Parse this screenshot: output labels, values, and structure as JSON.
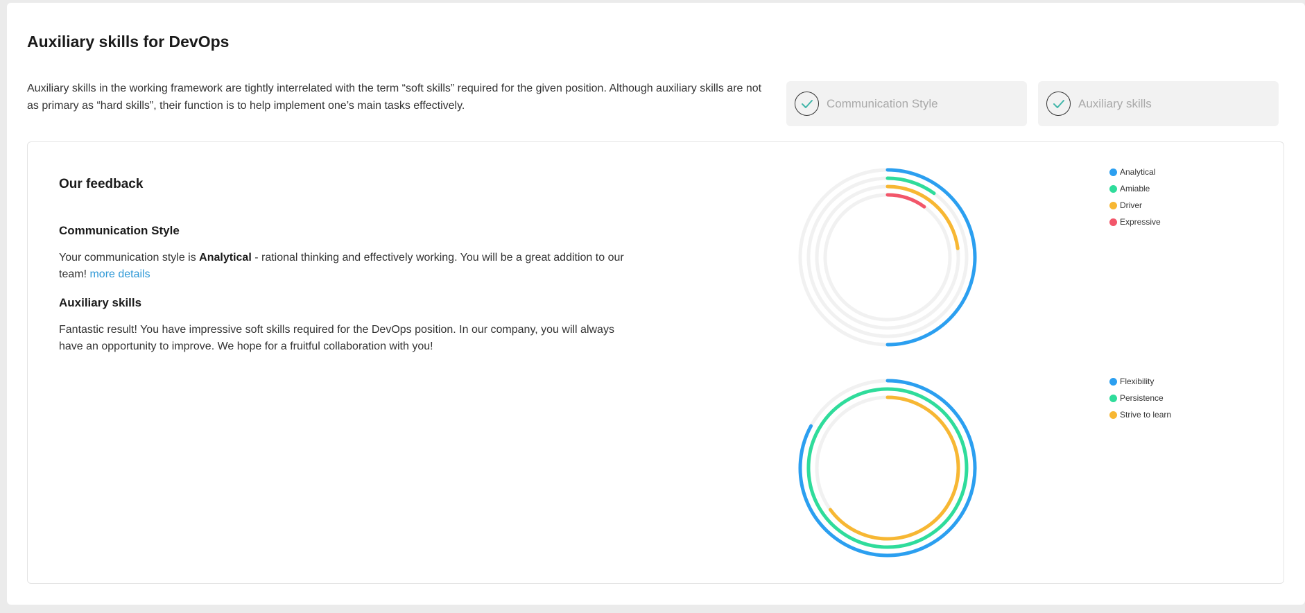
{
  "page": {
    "title": "Auxiliary skills for DevOps",
    "intro": "Auxiliary skills in the working framework are tightly interrelated with the term “soft skills” required for the given position. Although auxiliary skills are not as primary as “hard skills”, their function is to help implement one’s main tasks effectively."
  },
  "steps": [
    {
      "label": "Communication Style",
      "icon": "check-icon"
    },
    {
      "label": "Auxiliary skills",
      "icon": "check-icon"
    }
  ],
  "feedback": {
    "title": "Our feedback",
    "communication": {
      "heading": "Communication Style",
      "text_before": "Your communication style is ",
      "style_name": "Analytical",
      "text_after": " - rational thinking and effectively working. You will be a great addition to our team! ",
      "link_label": "more details"
    },
    "auxiliary": {
      "heading": "Auxiliary skills",
      "text": "Fantastic result! You have impressive soft skills required for the DevOps position. In our company, you will always have an opportunity to improve. We hope for a fruitful collaboration with you!"
    }
  },
  "colors": {
    "track": "#f1f1f1",
    "blue": "#2b9ff0",
    "green": "#2fdc9b",
    "orange": "#f7b733",
    "red": "#f2566a",
    "accent_check": "#3fb5a8"
  },
  "chart_data": [
    {
      "type": "radial-bar",
      "series": [
        {
          "name": "Analytical",
          "value": 0.5,
          "color": "#2b9ff0"
        },
        {
          "name": "Amiable",
          "value": 0.1,
          "color": "#2fdc9b"
        },
        {
          "name": "Driver",
          "value": 0.23,
          "color": "#f7b733"
        },
        {
          "name": "Expressive",
          "value": 0.1,
          "color": "#f2566a"
        }
      ],
      "legend": "top-right"
    },
    {
      "type": "radial-bar",
      "series": [
        {
          "name": "Flexibility",
          "value": 0.83,
          "color": "#2b9ff0"
        },
        {
          "name": "Persistence",
          "value": 1.0,
          "color": "#2fdc9b"
        },
        {
          "name": "Strive to learn",
          "value": 0.65,
          "color": "#f7b733"
        }
      ],
      "legend": "top-right"
    }
  ]
}
